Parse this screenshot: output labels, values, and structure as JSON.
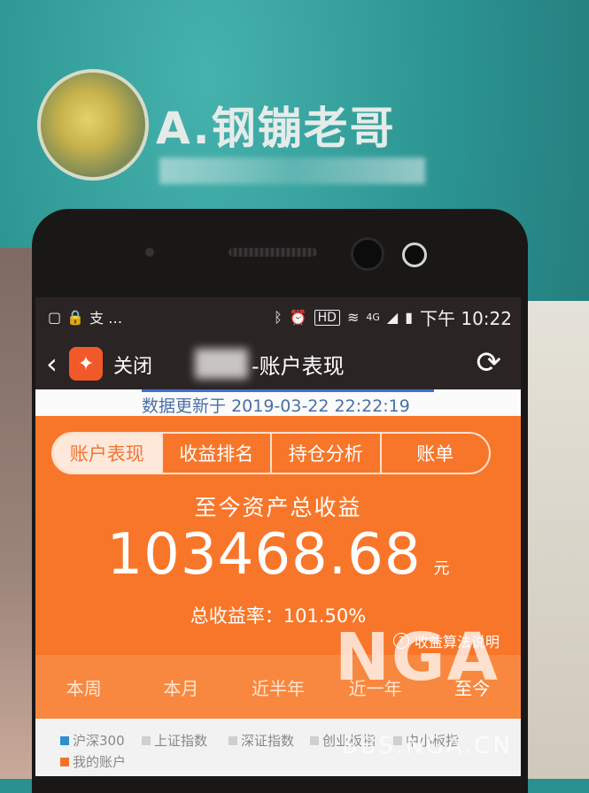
{
  "background": {
    "contact_name": "A.钢镚老哥"
  },
  "statusbar": {
    "left_text": "支 …",
    "hd": "HD",
    "network": "4G",
    "time": "下午 10:22"
  },
  "navbar": {
    "close_label": "关闭",
    "title": "-账户表现"
  },
  "update": {
    "label": "数据更新于",
    "timestamp": "2019-03-22 22:22:19"
  },
  "tabs": [
    {
      "label": "账户表现",
      "active": true
    },
    {
      "label": "收益排名",
      "active": false
    },
    {
      "label": "持仓分析",
      "active": false
    },
    {
      "label": "账单",
      "active": false
    }
  ],
  "summary": {
    "title": "至今资产总收益",
    "value": "103468.68",
    "unit": "元",
    "rate_label": "总收益率：101.50%",
    "method_label": "收益算法说明"
  },
  "periods": [
    {
      "label": "本周",
      "active": false
    },
    {
      "label": "本月",
      "active": false
    },
    {
      "label": "近半年",
      "active": false
    },
    {
      "label": "近一年",
      "active": false
    },
    {
      "label": "至今",
      "active": true
    }
  ],
  "legend": [
    {
      "label": "沪深300",
      "color": "#2f8fd1"
    },
    {
      "label": "上证指数",
      "color": "#cfcfcf"
    },
    {
      "label": "深证指数",
      "color": "#cfcfcf"
    },
    {
      "label": "创业板指",
      "color": "#cfcfcf"
    },
    {
      "label": "中小板指",
      "color": "#cfcfcf"
    },
    {
      "label": "我的账户",
      "color": "#f0722a"
    }
  ],
  "watermark": {
    "brand": "NGA",
    "url": "BBS.NGA.CN"
  },
  "colors": {
    "accent": "#f8762a",
    "update_text": "#4b6fa6"
  }
}
